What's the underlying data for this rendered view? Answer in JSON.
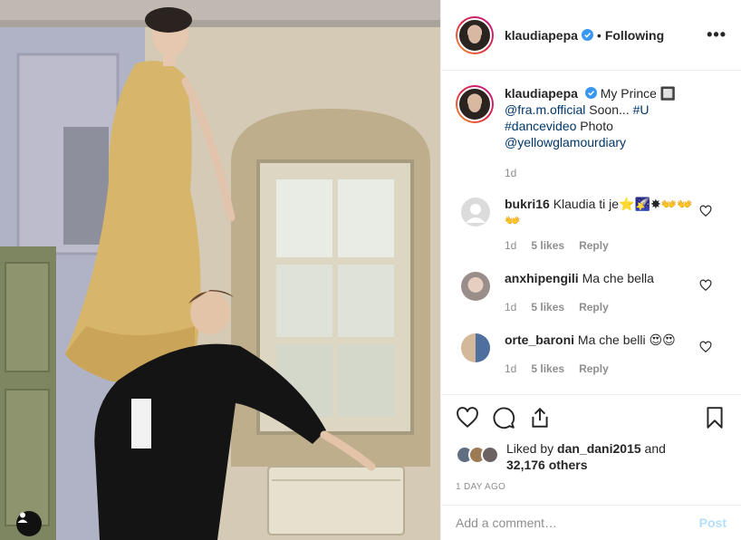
{
  "post": {
    "author": "klaudiapepa",
    "follow_state": "Following",
    "separator": "•",
    "more_label": "•••",
    "photo_alt": "klaudiapepa photo"
  },
  "caption": {
    "author": "klaudiapepa",
    "text_1": " My Prince 🔲 ",
    "mention_1": "@fra.m.official",
    "text_2": " Soon... ",
    "hashtag": "#U #dancevideo",
    "text_3": " Photo ",
    "mention_2": "@yellowglamourdiary",
    "time": "1d"
  },
  "comments": [
    {
      "user": "bukri16",
      "text": " Klaudia ti je⭐🌠✸👐👐👐",
      "time": "1d",
      "likes": "5 likes",
      "reply": "Reply",
      "avatar": "default-avatar"
    },
    {
      "user": "anxhipengili",
      "text": " Ma che bella",
      "time": "1d",
      "likes": "5 likes",
      "reply": "Reply",
      "avatar": "photo-avatar"
    },
    {
      "user": "orte_baroni",
      "text": " Ma che belli 😍😍",
      "time": "1d",
      "likes": "5 likes",
      "reply": "Reply",
      "avatar": "photo-avatar"
    }
  ],
  "likes": {
    "prefix": "Liked by ",
    "user": "dan_dani2015",
    "middle": " and",
    "count": "32,176 others"
  },
  "time_ago": "1 DAY AGO",
  "comment_box": {
    "placeholder": "Add a comment…",
    "post_label": "Post"
  },
  "colors": {
    "accent_link": "#00376b",
    "post_button": "#b2dffc",
    "muted": "#8e8e8e",
    "verified": "#3897f0"
  },
  "icons": [
    "heart-icon",
    "comment-icon",
    "share-icon",
    "bookmark-icon",
    "verified-icon",
    "more-icon",
    "user-tag-icon"
  ]
}
